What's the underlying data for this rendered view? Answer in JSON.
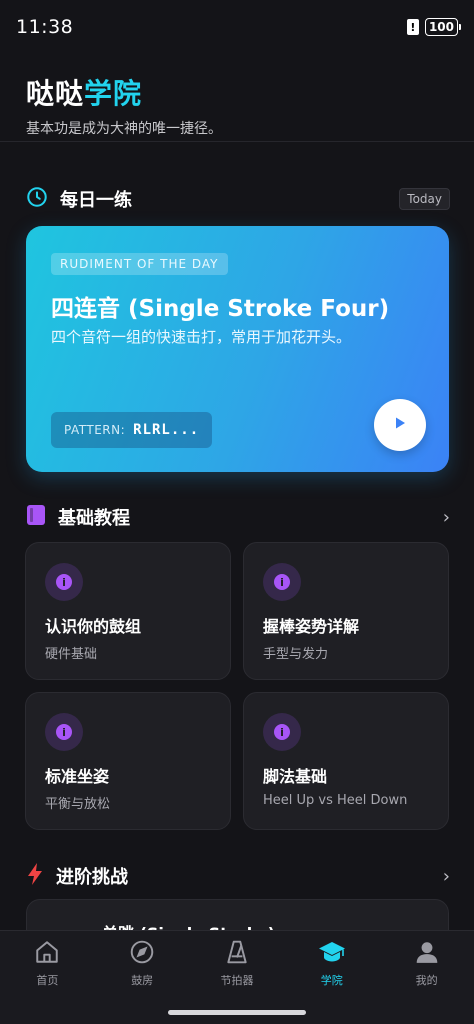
{
  "status_bar": {
    "time": "11:38",
    "battery": "100",
    "alert": "!"
  },
  "header": {
    "title_part1": "哒哒",
    "title_part2": "学院",
    "subtitle": "基本功是成为大神的唯一捷径。"
  },
  "daily": {
    "section_title": "每日一练",
    "badge": "Today",
    "tag": "RUDIMENT OF THE DAY",
    "title": "四连音 (Single Stroke Four)",
    "description": "四个音符一组的快速击打，常用于加花开头。",
    "pattern_label": "PATTERN:",
    "pattern_value": "RLRL..."
  },
  "basics": {
    "section_title": "基础教程",
    "chevron": "›",
    "tiles": [
      {
        "title": "认识你的鼓组",
        "subtitle": "硬件基础",
        "icon_glyph": "i"
      },
      {
        "title": "握棒姿势详解",
        "subtitle": "手型与发力",
        "icon_glyph": "i"
      },
      {
        "title": "标准坐姿",
        "subtitle": "平衡与放松",
        "icon_glyph": "i"
      },
      {
        "title": "脚法基础",
        "subtitle": "Heel Up vs Heel Down",
        "icon_glyph": "i"
      }
    ]
  },
  "advanced": {
    "section_title": "进阶挑战",
    "chevron": "›",
    "card_title": "单跳 (Single Stroke)"
  },
  "nav": {
    "items": [
      {
        "label": "首页",
        "icon": "home-icon"
      },
      {
        "label": "鼓房",
        "icon": "compass-icon"
      },
      {
        "label": "节拍器",
        "icon": "metronome-icon"
      },
      {
        "label": "学院",
        "icon": "graduation-cap-icon",
        "active": true
      },
      {
        "label": "我的",
        "icon": "user-icon"
      }
    ]
  },
  "colors": {
    "accent": "#22d3ee",
    "purple": "#a855f7",
    "red": "#ef4444",
    "background": "#141418"
  }
}
